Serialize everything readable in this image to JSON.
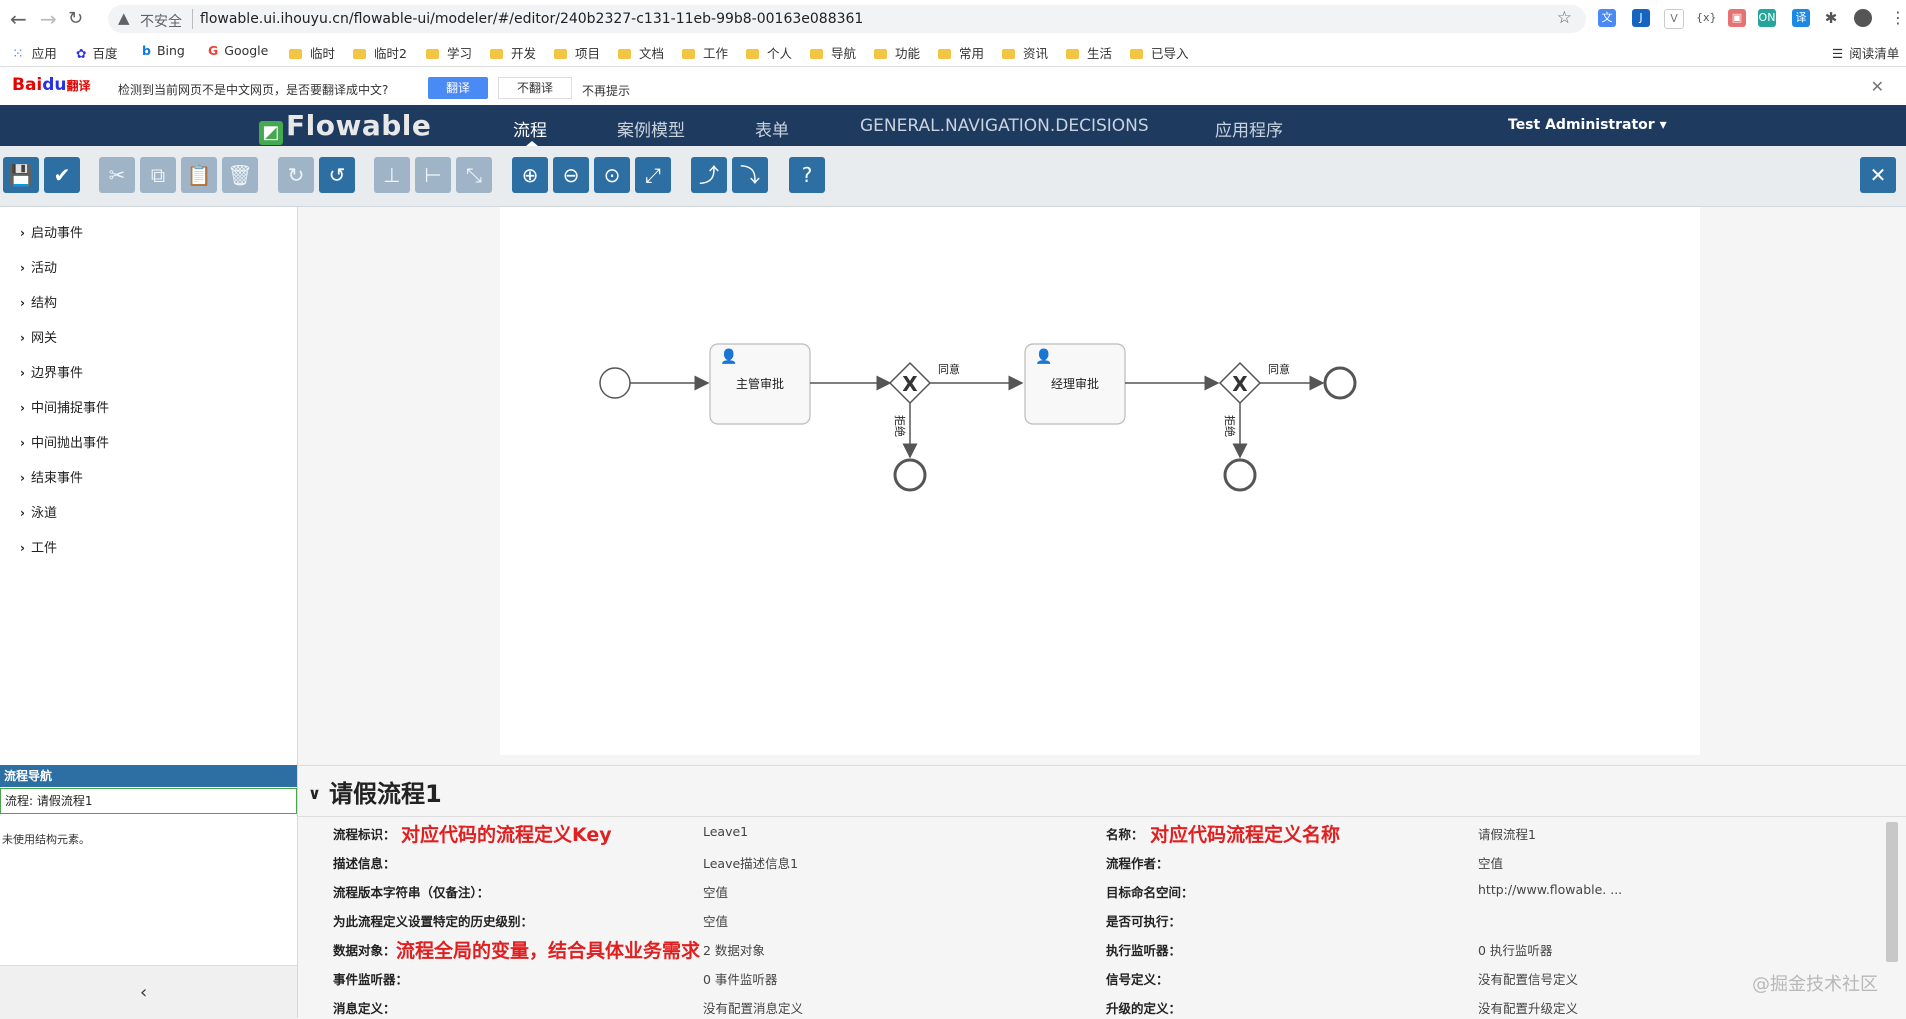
{
  "browser": {
    "security_label": "不安全",
    "url": "flowable.ui.ihouyu.cn/flowable-ui/modeler/#/editor/240b2327-c131-11eb-99b8-00163e088361"
  },
  "bookmarks": [
    "应用",
    "百度",
    "Bing",
    "Google",
    "临时",
    "临时2",
    "学习",
    "开发",
    "项目",
    "文档",
    "工作",
    "个人",
    "导航",
    "功能",
    "常用",
    "资讯",
    "生活",
    "已导入"
  ],
  "reading_list": "阅读清单",
  "translate_bar": {
    "logo": "Bai",
    "logo2": "du",
    "logo_cn": "翻译",
    "message": "检测到当前网页不是中文网页，是否要翻译成中文?",
    "translate": "翻译",
    "no_translate": "不翻译",
    "never": "不再提示"
  },
  "app": {
    "brand": "Flowable",
    "nav": [
      "流程",
      "案例模型",
      "表单",
      "GENERAL.NAVIGATION.DECISIONS",
      "应用程序"
    ],
    "user": "Test Administrator"
  },
  "palette": [
    "启动事件",
    "活动",
    "结构",
    "网关",
    "边界事件",
    "中间捕捉事件",
    "中间抛出事件",
    "结束事件",
    "泳道",
    "工件"
  ],
  "diagram": {
    "task1": "主管审批",
    "task2": "经理审批",
    "gw1_label": "同意",
    "gw1_reject": "拒绝",
    "gw2_label": "同意",
    "gw2_reject": "拒绝",
    "gateway_symbol": "X"
  },
  "navigator": {
    "header": "流程导航",
    "process": "流程: 请假流程1",
    "unused": "未使用结构元素。"
  },
  "properties": {
    "title": "请假流程1",
    "rows_left": [
      {
        "label": "流程标识：",
        "value": "Leave1"
      },
      {
        "label": "描述信息：",
        "value": "Leave描述信息1"
      },
      {
        "label": "流程版本字符串（仅备注）：",
        "value": "空值"
      },
      {
        "label": "为此流程定义设置特定的历史级别：",
        "value": "空值"
      },
      {
        "label": "数据对象：",
        "value": "2 数据对象"
      },
      {
        "label": "事件监听器：",
        "value": "0 事件监听器"
      },
      {
        "label": "消息定义：",
        "value": "没有配置消息定义"
      }
    ],
    "rows_right": [
      {
        "label": "名称：",
        "value": "请假流程1"
      },
      {
        "label": "流程作者：",
        "value": "空值"
      },
      {
        "label": "目标命名空间：",
        "value": "http://www.flowable. ..."
      },
      {
        "label": "是否可执行：",
        "value": ""
      },
      {
        "label": "执行监听器：",
        "value": "0 执行监听器"
      },
      {
        "label": "信号定义：",
        "value": "没有配置信号定义"
      },
      {
        "label": "升级的定义：",
        "value": "没有配置升级定义"
      }
    ],
    "annotations": {
      "key_note": "对应代码的流程定义Key",
      "name_note": "对应代码流程定义名称",
      "data_note": "流程全局的变量，结合具体业务需求"
    }
  },
  "watermark": "@掘金技术社区",
  "colors": {
    "navbar": "#1e3a5f",
    "toolbar_button": "#2e6fa3",
    "annotation_red": "#e02020"
  }
}
